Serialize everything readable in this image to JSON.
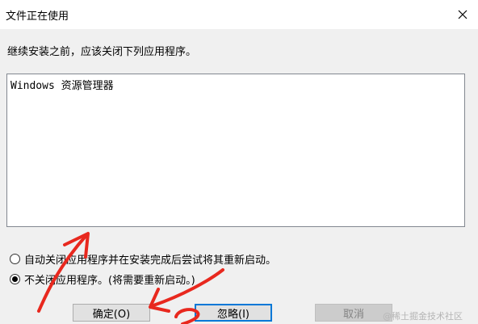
{
  "window": {
    "title": "文件正在使用",
    "close_icon": "close-icon"
  },
  "message": "继续安装之前，应该关闭下列应用程序。",
  "app_list": {
    "items": [
      "Windows 资源管理器"
    ]
  },
  "options": [
    {
      "label": "自动关闭应用程序并在安装完成后尝试将其重新启动。",
      "selected": false
    },
    {
      "label": "不关闭应用程序。(将需要重新启动。)",
      "selected": true
    }
  ],
  "buttons": {
    "ok": "确定(O)",
    "ignore": "忽略(I)",
    "cancel": "取消"
  },
  "colors": {
    "annotation": "#e8281e",
    "focus_border": "#0078d7"
  },
  "watermark": "@稀土掘金技术社区"
}
